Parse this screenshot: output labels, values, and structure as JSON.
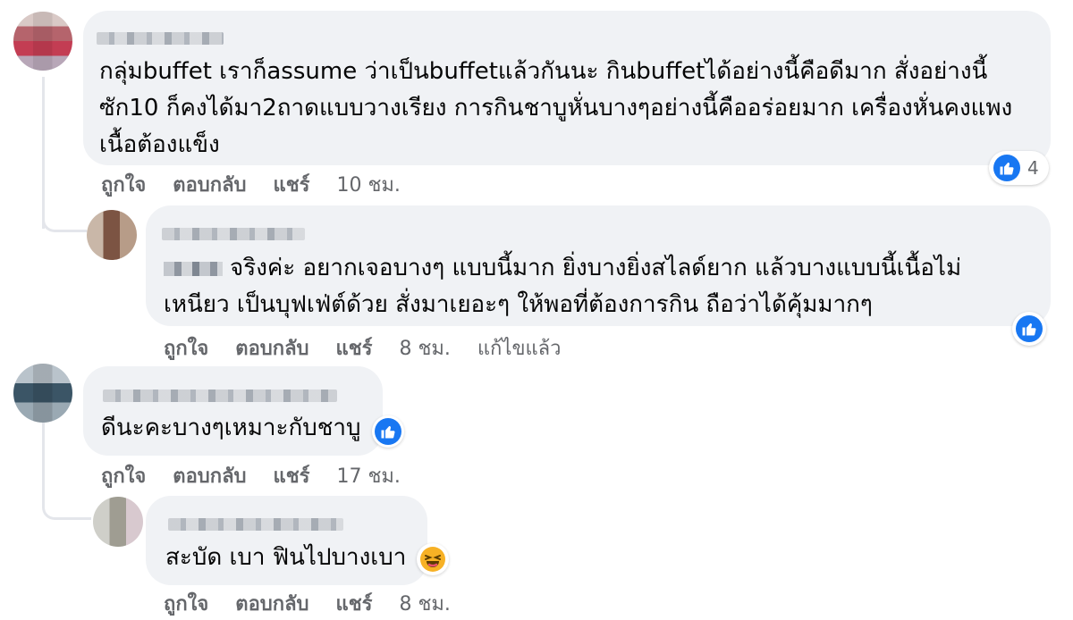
{
  "colors": {
    "accent": "#1877f2",
    "bubble": "#f0f2f5",
    "muted": "#65676b",
    "text": "#050505"
  },
  "action_labels": {
    "like": "ถูกใจ",
    "reply": "ตอบกลับ",
    "share": "แชร์"
  },
  "comments": [
    {
      "text_lines": [
        "กลุ่มbuffet เราก็assume ว่าเป็นbuffetแล้วกันนะ กินbuffetได้อย่างนี้คือดีมาก สั่งอย่างนี้",
        "ซัก10 ก็คงได้มา2ถาดแบบวางเรียง การกินชาบูหั่นบางๆอย่างนี้คืออร่อยมาก เครื่องหั่นคงแพง",
        "เนื้อต้องแข็ง"
      ],
      "time": "10 ชม.",
      "reaction": {
        "icon": "like-icon",
        "count": "4"
      }
    },
    {
      "text_lines": [
        "จริงค่ะ อยากเจอบางๆ แบบนี้มาก ยิ่งบางยิ่งสไลด์ยาก แล้วบางแบบนี้เนื้อไม่",
        "เหนียว เป็นบุฟเฟ่ต์ด้วย สั่งมาเยอะๆ ให้พอที่ต้องการกิน ถือว่าได้คุ้มมากๆ"
      ],
      "time": "8 ชม.",
      "edited": "แก้ไขแล้ว",
      "reaction": {
        "icon": "like-icon"
      }
    },
    {
      "text_lines": [
        "ดีนะคะบางๆเหมาะกับชาบู"
      ],
      "time": "17 ชม.",
      "reaction": {
        "icon": "like-icon"
      }
    },
    {
      "text_lines": [
        "สะบัด เบา ฟินไปบางเบา"
      ],
      "time": "8 ชม.",
      "reaction": {
        "icon": "laughing-emoji-icon"
      }
    }
  ]
}
